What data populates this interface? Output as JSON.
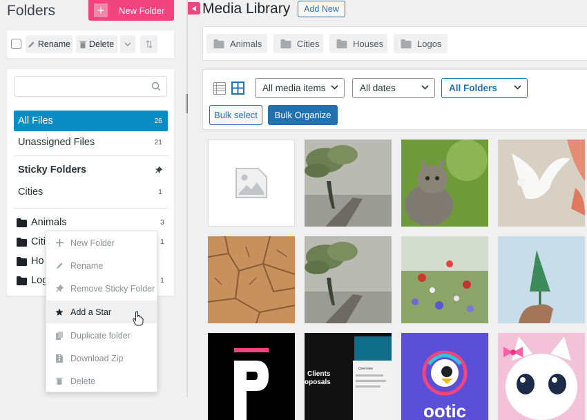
{
  "sidebar": {
    "title": "Folders",
    "new_folder_label": "New Folder",
    "toolbar": {
      "rename_label": "Rename",
      "delete_label": "Delete"
    },
    "search": {
      "placeholder": ""
    },
    "all_files": {
      "label": "All Files",
      "count": "26"
    },
    "unassigned": {
      "label": "Unassigned Files",
      "count": "21"
    },
    "sticky_heading": "Sticky Folders",
    "sticky_items": [
      {
        "label": "Cities",
        "count": "1"
      }
    ],
    "folders": [
      {
        "label": "Animals",
        "count": "3"
      },
      {
        "label": "Citi",
        "count": "1"
      },
      {
        "label": "Ho",
        "count": ""
      },
      {
        "label": "Log",
        "count": "1"
      }
    ]
  },
  "context_menu": {
    "items": [
      {
        "label": "New Folder",
        "icon": "plus-icon"
      },
      {
        "label": "Rename",
        "icon": "pencil-icon"
      },
      {
        "label": "Remove Sticky Folder",
        "icon": "pin-icon"
      },
      {
        "label": "Add a Star",
        "icon": "star-icon"
      },
      {
        "label": "Duplicate folder",
        "icon": "copy-icon"
      },
      {
        "label": "Download Zip",
        "icon": "zip-icon"
      },
      {
        "label": "Delete",
        "icon": "trash-icon"
      }
    ],
    "hovered_index": 3
  },
  "main": {
    "title": "Media Library",
    "add_new_label": "Add New",
    "folder_chips": [
      "Animals",
      "Cities",
      "Houses",
      "Logos"
    ],
    "filters": {
      "media_type": "All media items",
      "dates": "All dates",
      "folders": "All Folders"
    },
    "bulk_select_label": "Bulk select",
    "bulk_organize_label": "Bulk Organize",
    "thumb_text": {
      "clients": "Clients",
      "proposals": "oposals",
      "overview": "Overview",
      "logo_word": "ootic"
    }
  },
  "colors": {
    "accent_pink": "#f0457e",
    "active_blue": "#0a8cc4",
    "wp_blue": "#2271b1"
  }
}
